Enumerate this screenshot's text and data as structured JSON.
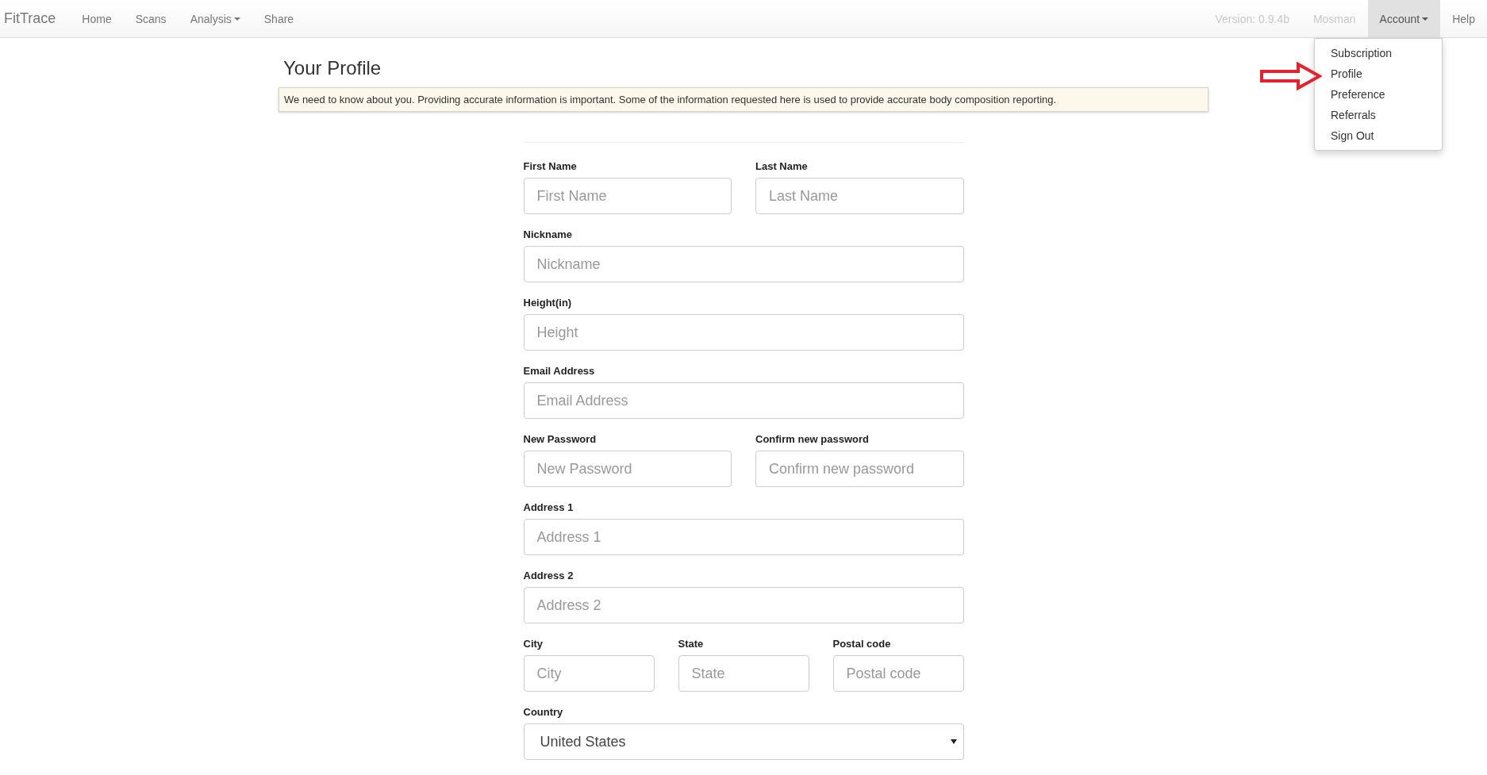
{
  "navbar": {
    "brand": "FitTrace",
    "left_items": [
      {
        "label": "Home",
        "dropdown": false,
        "selected": false
      },
      {
        "label": "Scans",
        "dropdown": false,
        "selected": false
      },
      {
        "label": "Analysis",
        "dropdown": true,
        "selected": false
      },
      {
        "label": "Share",
        "dropdown": false,
        "selected": false
      }
    ],
    "right_items": [
      {
        "label": "Version: 0.9.4b",
        "kind": "text"
      },
      {
        "label": "Mosman",
        "kind": "text"
      },
      {
        "label": "Account",
        "kind": "link",
        "dropdown": true,
        "selected": true
      },
      {
        "label": "Help",
        "kind": "link",
        "dropdown": false,
        "selected": false
      }
    ]
  },
  "account_menu": [
    "Subscription",
    "Profile",
    "Preference",
    "Referrals",
    "Sign Out"
  ],
  "page_title": "Your Profile",
  "notice": "We need to know about you. Providing accurate information is important. Some of the information requested here is used to provide accurate body composition reporting.",
  "form_rows": [
    [
      {
        "label": "First Name",
        "kind": "input",
        "placeholder": "First Name"
      },
      {
        "label": "Last Name",
        "kind": "input",
        "placeholder": "Last Name"
      }
    ],
    [
      {
        "label": "Nickname",
        "kind": "input",
        "placeholder": "Nickname"
      }
    ],
    [
      {
        "label": "Height(in)",
        "kind": "input",
        "placeholder": "Height"
      }
    ],
    [
      {
        "label": "Email Address",
        "kind": "input",
        "placeholder": "Email Address"
      }
    ],
    [
      {
        "label": "New Password",
        "kind": "input",
        "placeholder": "New Password"
      },
      {
        "label": "Confirm new password",
        "kind": "input",
        "placeholder": "Confirm new password"
      }
    ],
    [
      {
        "label": "Address 1",
        "kind": "input",
        "placeholder": "Address 1"
      }
    ],
    [
      {
        "label": "Address 2",
        "kind": "input",
        "placeholder": "Address 2"
      }
    ],
    [
      {
        "label": "City",
        "kind": "input",
        "placeholder": "City"
      },
      {
        "label": "State",
        "kind": "input",
        "placeholder": "State"
      },
      {
        "label": "Postal code",
        "kind": "input",
        "placeholder": "Postal code"
      }
    ],
    [
      {
        "label": "Country",
        "kind": "select",
        "value": "United States"
      }
    ]
  ]
}
